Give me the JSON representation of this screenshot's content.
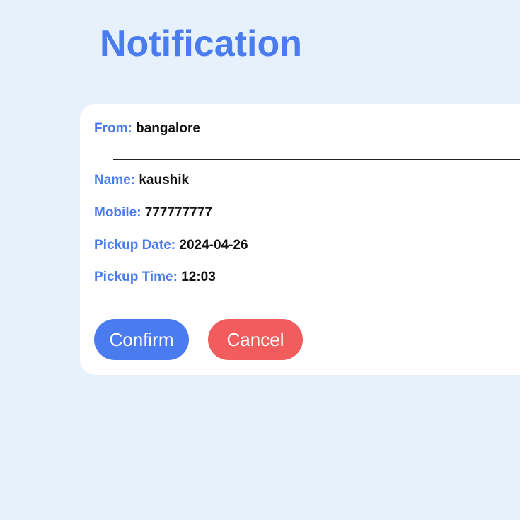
{
  "page": {
    "title": "Notification"
  },
  "notification": {
    "from": {
      "label": "From:",
      "value": "bangalore"
    },
    "name": {
      "label": "Name:",
      "value": "kaushik"
    },
    "mobile": {
      "label": "Mobile:",
      "value": "777777777"
    },
    "pickup_date": {
      "label": "Pickup Date:",
      "value": "2024-04-26"
    },
    "pickup_time": {
      "label": "Pickup Time:",
      "value": "12:03"
    }
  },
  "actions": {
    "confirm_label": "Confirm",
    "cancel_label": "Cancel"
  },
  "colors": {
    "accent": "#4a7cf0",
    "danger": "#f25c5c",
    "background": "#e6f1fc",
    "card": "#ffffff"
  }
}
